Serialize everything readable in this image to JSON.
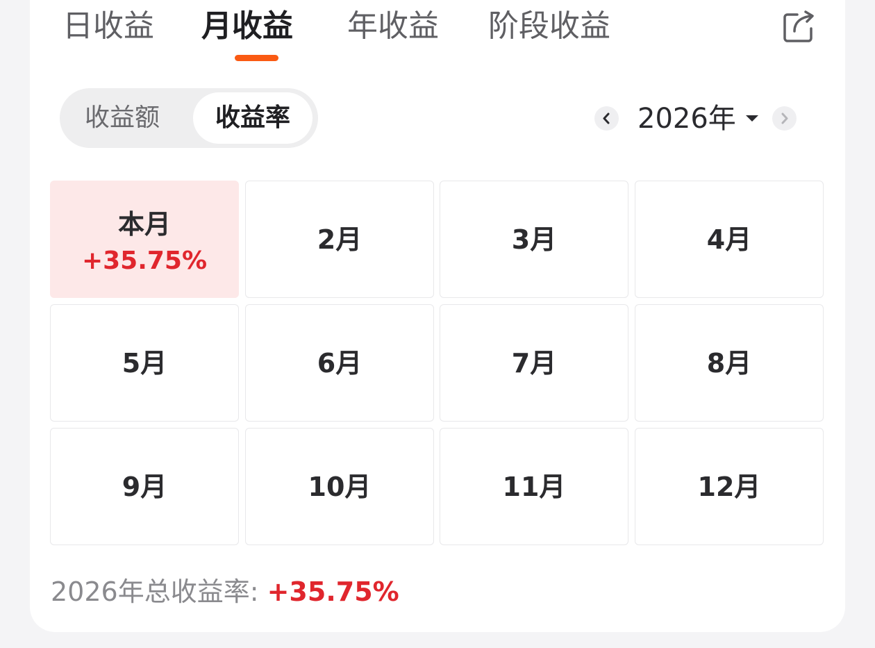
{
  "tabs": [
    {
      "label": "日收益",
      "active": false
    },
    {
      "label": "月收益",
      "active": true
    },
    {
      "label": "年收益",
      "active": false
    },
    {
      "label": "阶段收益",
      "active": false
    }
  ],
  "toggle": {
    "amount_label": "收益额",
    "rate_label": "收益率",
    "selected": "收益率"
  },
  "year_selector": {
    "value": "2026年"
  },
  "months": [
    {
      "label": "本月",
      "value": "+35.75%"
    },
    {
      "label": "2月"
    },
    {
      "label": "3月"
    },
    {
      "label": "4月"
    },
    {
      "label": "5月"
    },
    {
      "label": "6月"
    },
    {
      "label": "7月"
    },
    {
      "label": "8月"
    },
    {
      "label": "9月"
    },
    {
      "label": "10月"
    },
    {
      "label": "11月"
    },
    {
      "label": "12月"
    }
  ],
  "summary": {
    "label": "2026年总收益率: ",
    "value": "+35.75%"
  },
  "colors": {
    "accent": "#fa5a13",
    "positive": "#e0262d",
    "current_month_bg": "#fde8e8"
  },
  "icons": {
    "share": "share-icon",
    "prev": "chevron-left-icon",
    "next": "chevron-right-icon",
    "dropdown": "caret-down-icon"
  }
}
